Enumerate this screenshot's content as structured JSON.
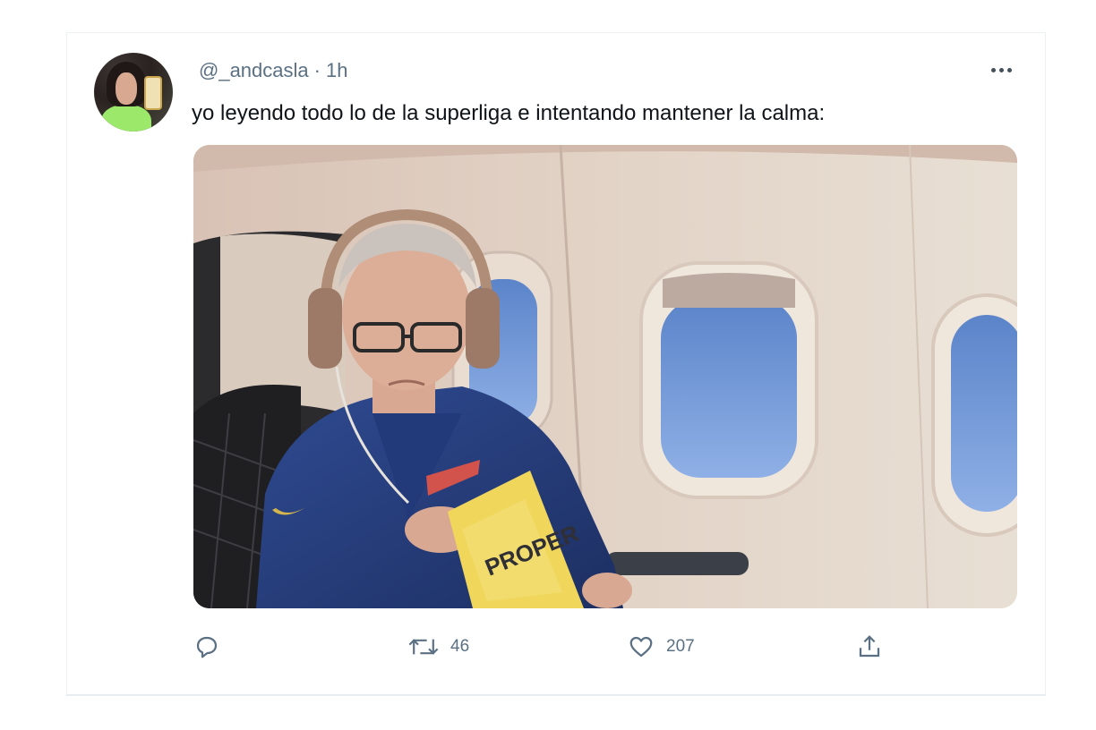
{
  "tweet": {
    "handle": "@_andcasla",
    "separator": "·",
    "time": "1h",
    "text": "yo leyendo todo lo de la superliga e intentando mantener la calma:",
    "media_text": "PROPER"
  },
  "actions": {
    "reply_icon": "reply-icon",
    "retweet_icon": "retweet-icon",
    "retweet_count": "46",
    "like_icon": "heart-icon",
    "like_count": "207",
    "share_icon": "share-icon"
  },
  "colors": {
    "text": "#0f1419",
    "secondary": "#5b7083",
    "border": "#e6ecf0"
  }
}
